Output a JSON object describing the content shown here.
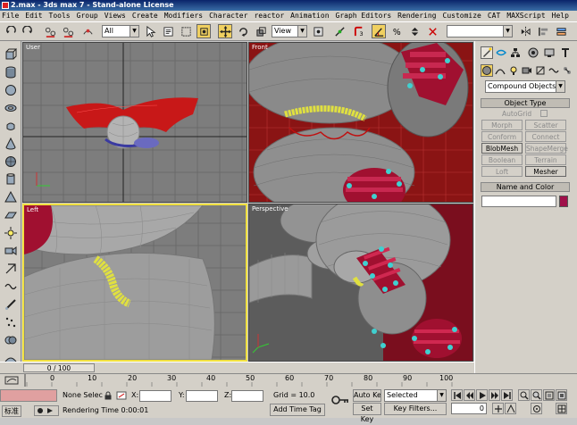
{
  "title": "2.max - 3ds max 7 - Stand-alone License",
  "menu": [
    "File",
    "Edit",
    "Tools",
    "Group",
    "Views",
    "Create",
    "Modifiers",
    "Character",
    "reactor",
    "Animation",
    "Graph Editors",
    "Rendering",
    "Customize",
    "CAT",
    "MAXScript",
    "Help"
  ],
  "toolbar": {
    "selection_filter": "All",
    "ref_coord": "View"
  },
  "viewports": {
    "top": "User",
    "front": "Front",
    "left": "Left",
    "persp": "Perspective"
  },
  "command_panel": {
    "category": "Compound Objects",
    "object_type_title": "Object Type",
    "autogrid": "AutoGrid",
    "buttons": [
      "Morph",
      "Scatter",
      "Conform",
      "Connect",
      "BlobMesh",
      "ShapeMerge",
      "Boolean",
      "Terrain",
      "Loft",
      "Mesher"
    ],
    "name_color_title": "Name and Color",
    "color": "#a0104a"
  },
  "timeline": {
    "frame": "0 / 100",
    "ticks": [
      "0",
      "10",
      "20",
      "30",
      "40",
      "50",
      "60",
      "70",
      "80",
      "90",
      "100"
    ]
  },
  "status": {
    "selection": "None Selec",
    "x_label": "X:",
    "y_label": "Y:",
    "z_label": "Z:",
    "grid": "Grid = 10.0",
    "autokey": "Auto Key",
    "selected": "Selected",
    "setkey": "Set Key",
    "keyfilters": "Key Filters...",
    "rendering": "Rendering Time  0:00:01",
    "addtag": "Add Time Tag",
    "ime": "标准",
    "frame_field": "0"
  }
}
